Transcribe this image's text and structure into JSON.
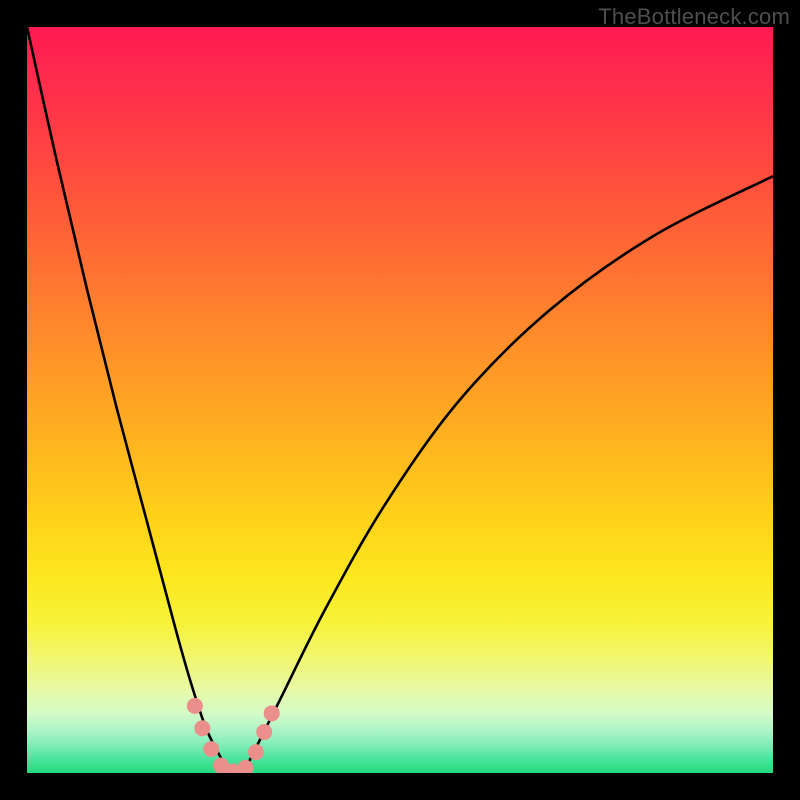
{
  "watermark": "TheBottleneck.com",
  "colors": {
    "frame": "#000000",
    "curve": "#000000",
    "markers": "#eb8f8b",
    "gradient_top": "#ff1a52",
    "gradient_bottom": "#24d97e"
  },
  "chart_data": {
    "type": "line",
    "title": "",
    "xlabel": "",
    "ylabel": "",
    "xlim": [
      0,
      100
    ],
    "ylim": [
      0,
      100
    ],
    "grid": false,
    "legend": false,
    "series": [
      {
        "name": "bottleneck-curve",
        "x": [
          0,
          4,
          8,
          12,
          16,
          20,
          22,
          24,
          26,
          27,
          28,
          29,
          30,
          34,
          40,
          48,
          58,
          70,
          84,
          100
        ],
        "y": [
          100,
          82,
          65,
          49,
          34,
          19,
          12,
          6,
          2,
          0.3,
          0,
          0.3,
          2,
          10,
          22,
          36,
          50,
          62,
          72,
          80
        ]
      }
    ],
    "markers": [
      {
        "x": 22.5,
        "y": 9.0
      },
      {
        "x": 23.5,
        "y": 6.0
      },
      {
        "x": 24.7,
        "y": 3.2
      },
      {
        "x": 26.0,
        "y": 1.0
      },
      {
        "x": 27.6,
        "y": 0.2
      },
      {
        "x": 29.3,
        "y": 0.7
      },
      {
        "x": 30.7,
        "y": 2.8
      },
      {
        "x": 31.8,
        "y": 5.5
      },
      {
        "x": 32.8,
        "y": 8.0
      }
    ],
    "marker_radius": 8
  }
}
